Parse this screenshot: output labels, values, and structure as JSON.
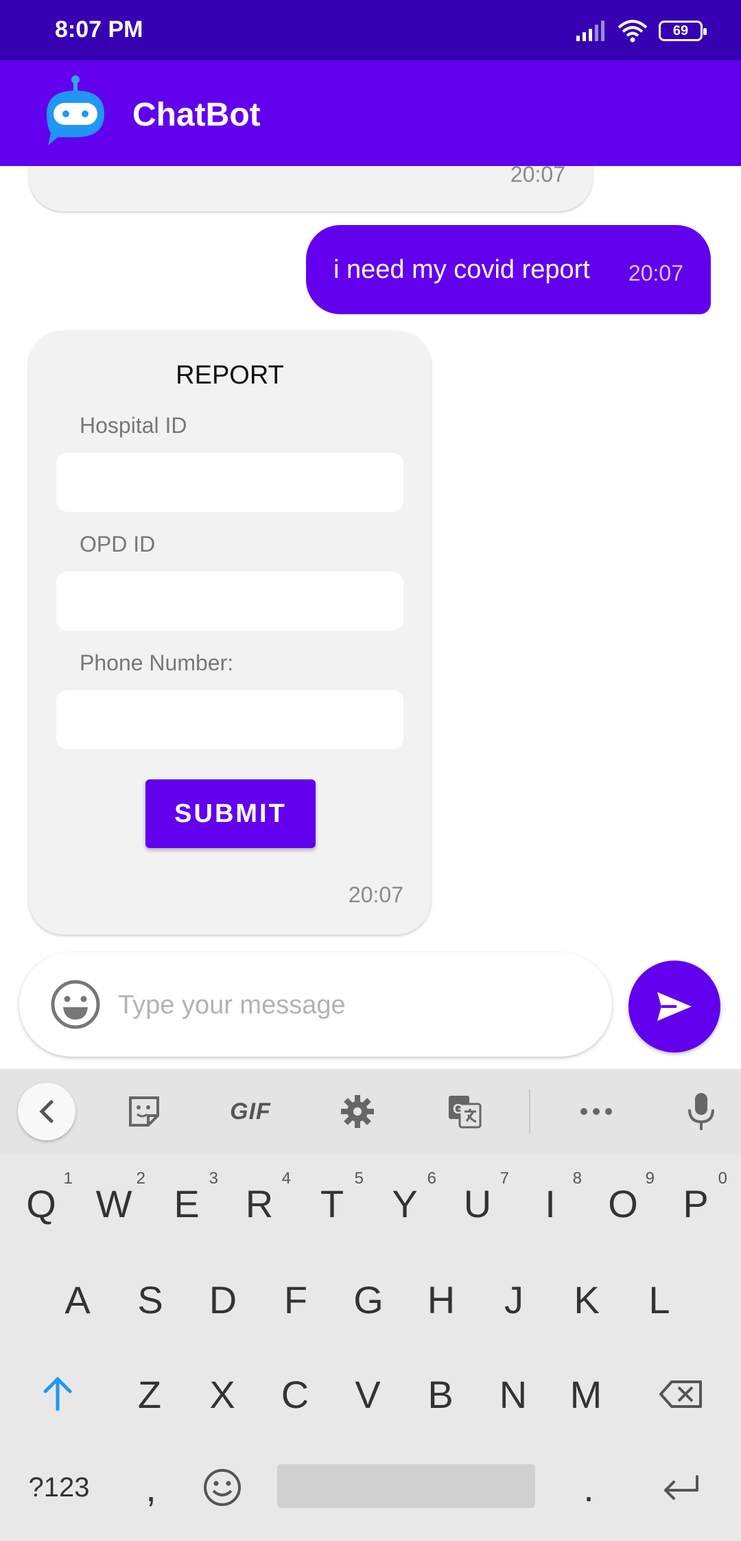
{
  "status_bar": {
    "time": "8:07 PM",
    "battery": "69"
  },
  "app_bar": {
    "title": "ChatBot",
    "logo_icon": "robot-chat-icon"
  },
  "colors": {
    "primary": "#6200ee",
    "status_bar": "#3700b3",
    "bubble_bg": "#f2f2f2"
  },
  "messages": {
    "previous_time": "20:07",
    "user_message": {
      "text": "i need my covid report",
      "time": "20:07"
    },
    "report_card": {
      "title": "REPORT",
      "fields": [
        {
          "label": "Hospital ID",
          "value": ""
        },
        {
          "label": "OPD ID",
          "value": ""
        },
        {
          "label": "Phone Number:",
          "value": ""
        }
      ],
      "submit_label": "SUBMIT",
      "time": "20:07"
    }
  },
  "composer": {
    "placeholder": "Type your message"
  },
  "keyboard": {
    "toolbar": {
      "gif_label": "GIF"
    },
    "row1": [
      {
        "key": "Q",
        "hint": "1"
      },
      {
        "key": "W",
        "hint": "2"
      },
      {
        "key": "E",
        "hint": "3"
      },
      {
        "key": "R",
        "hint": "4"
      },
      {
        "key": "T",
        "hint": "5"
      },
      {
        "key": "Y",
        "hint": "6"
      },
      {
        "key": "U",
        "hint": "7"
      },
      {
        "key": "I",
        "hint": "8"
      },
      {
        "key": "O",
        "hint": "9"
      },
      {
        "key": "P",
        "hint": "0"
      }
    ],
    "row2": [
      "A",
      "S",
      "D",
      "F",
      "G",
      "H",
      "J",
      "K",
      "L"
    ],
    "row3": [
      "Z",
      "X",
      "C",
      "V",
      "B",
      "N",
      "M"
    ],
    "bottom": {
      "symbols": "?123",
      "comma": ",",
      "period": "."
    }
  }
}
